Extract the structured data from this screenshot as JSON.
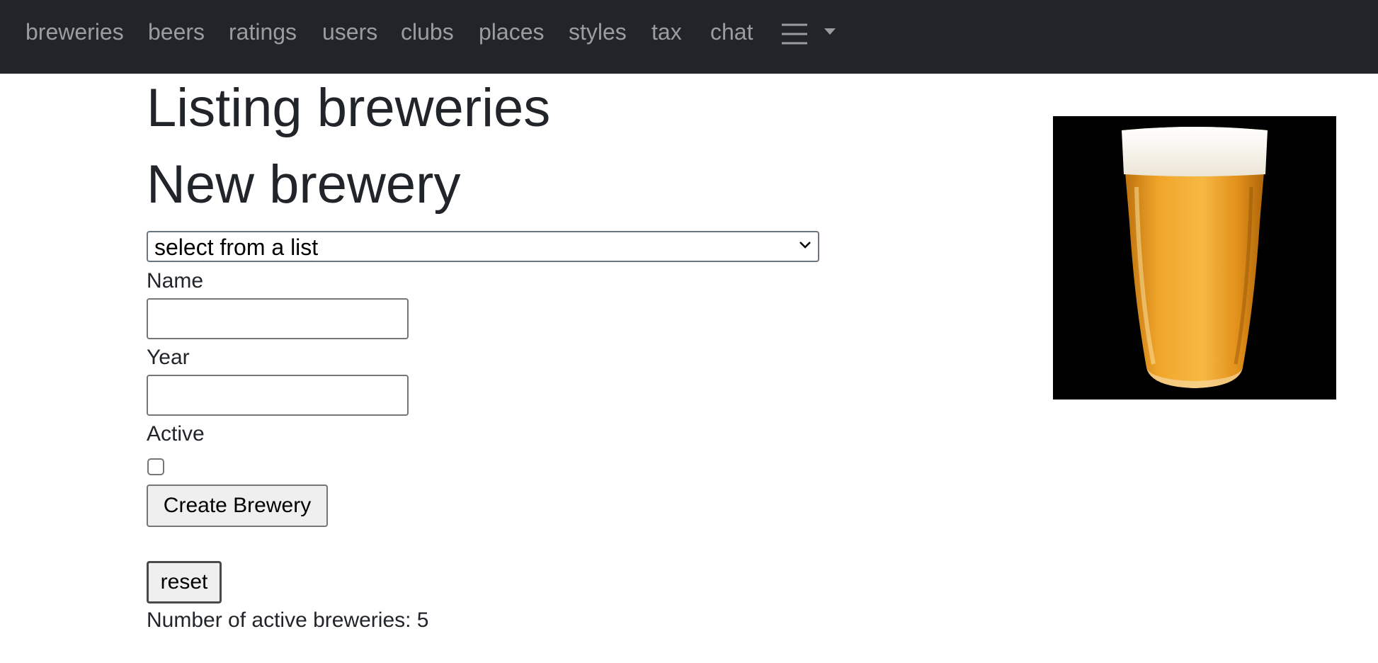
{
  "navbar": {
    "links": [
      "breweries",
      "beers",
      "ratings",
      "users",
      "clubs",
      "places",
      "styles",
      "tax",
      "chat"
    ],
    "menu_icons": [
      "hamburger-icon",
      "caret-down-icon"
    ]
  },
  "page": {
    "title": "Listing breweries",
    "form_heading": "New brewery"
  },
  "form": {
    "select_value": "select from a list",
    "name_label": "Name",
    "name_value": "",
    "year_label": "Year",
    "year_value": "",
    "active_label": "Active",
    "active_checked": false,
    "submit_label": "Create Brewery"
  },
  "reset_label": "reset",
  "active_count_text": "Number of active breweries: 5",
  "image": {
    "subject": "pint glass of lager beer on black background",
    "colors": {
      "background": "#000000",
      "beer": "#e89a1c",
      "foam": "#f7f4ec"
    }
  },
  "colors": {
    "navbar_bg": "#212529",
    "nav_link": "rgba(255,255,255,0.55)",
    "text": "#212529"
  }
}
